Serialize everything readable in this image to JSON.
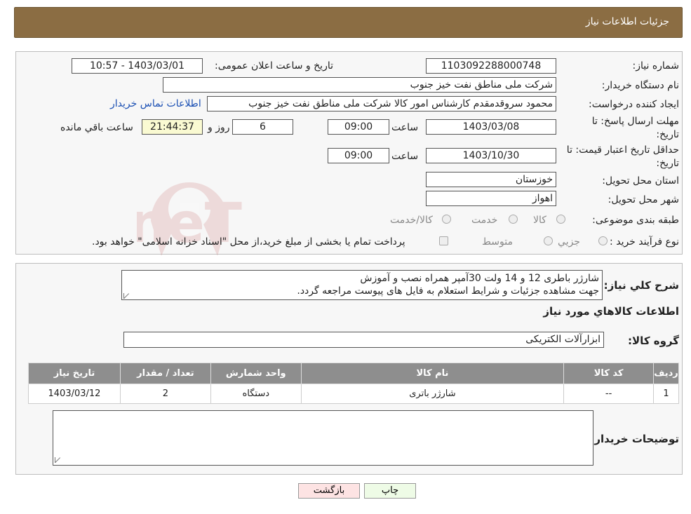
{
  "header": {
    "title": "جزئیات اطلاعات نیاز"
  },
  "fields": {
    "need_number_label": "شماره نیاز:",
    "need_number": "1103092288000748",
    "announce_label": "تاریخ و ساعت اعلان عمومی:",
    "announce_value": "1403/03/01 - 10:57",
    "buyer_org_label": "نام دستگاه خریدار:",
    "buyer_org": "شرکت ملی مناطق نفت خیز جنوب",
    "creator_label": "ایجاد کننده درخواست:",
    "creator": "محمود سروقدمقدم کارشناس امور کالا شرکت ملی مناطق نفت خیز جنوب",
    "contact_link": "اطلاعات تماس خریدار",
    "deadline_label_line1": "مهلت ارسال پاسخ: تا",
    "deadline_label_line2": "تاریخ:",
    "deadline_date": "1403/03/08",
    "time_label": "ساعت",
    "deadline_time": "09:00",
    "days_value": "6",
    "days_label": "روز و",
    "remaining_time": "21:44:37",
    "remaining_label": "ساعت باقي مانده",
    "validity_label_line1": "حداقل تاریخ اعتبار قیمت: تا",
    "validity_label_line2": "تاریخ:",
    "validity_date": "1403/10/30",
    "validity_time": "09:00",
    "province_label": "استان محل تحویل:",
    "province": "خوزستان",
    "city_label": "شهر محل تحویل:",
    "city": "اهواز",
    "category_label": "طبقه بندی موضوعی:",
    "category_options": [
      "کالا",
      "خدمت",
      "کالا/خدمت"
    ],
    "purchase_type_label": "نوع فرآیند خرید :",
    "purchase_options": [
      "جزیي",
      "متوسط"
    ],
    "purchase_note": "پرداخت تمام یا بخشی از مبلغ خرید،از محل \"اسناد خزانه اسلامی\" خواهد بود."
  },
  "description": {
    "label": "شرح کلي نياز:",
    "line1": "شارژر باطری 12 و 14 ولت 30آمپر همراه نصب و آموزش",
    "line2": "جهت مشاهده جزئیات و شرایط استعلام به فایل های پیوست مراجعه گردد."
  },
  "goods": {
    "section_title": "اطلاعات کالاهاي مورد نياز",
    "group_label": "گروه کالا:",
    "group_value": "ابزارآلات الکتریکی",
    "columns": [
      "رديف",
      "کد کالا",
      "نام کالا",
      "واحد شمارش",
      "تعداد / مقدار",
      "تاريخ نياز"
    ],
    "rows": [
      [
        "1",
        "--",
        "شارژر باتری",
        "دستگاه",
        "2",
        "1403/03/12"
      ]
    ]
  },
  "buyer_notes": {
    "label": "توضيحات خريدار:",
    "value": ""
  },
  "buttons": {
    "print": "چاپ",
    "back": "بازگشت"
  },
  "watermark": {
    "text": "AriaTender.neT",
    "color": "#b22222"
  }
}
